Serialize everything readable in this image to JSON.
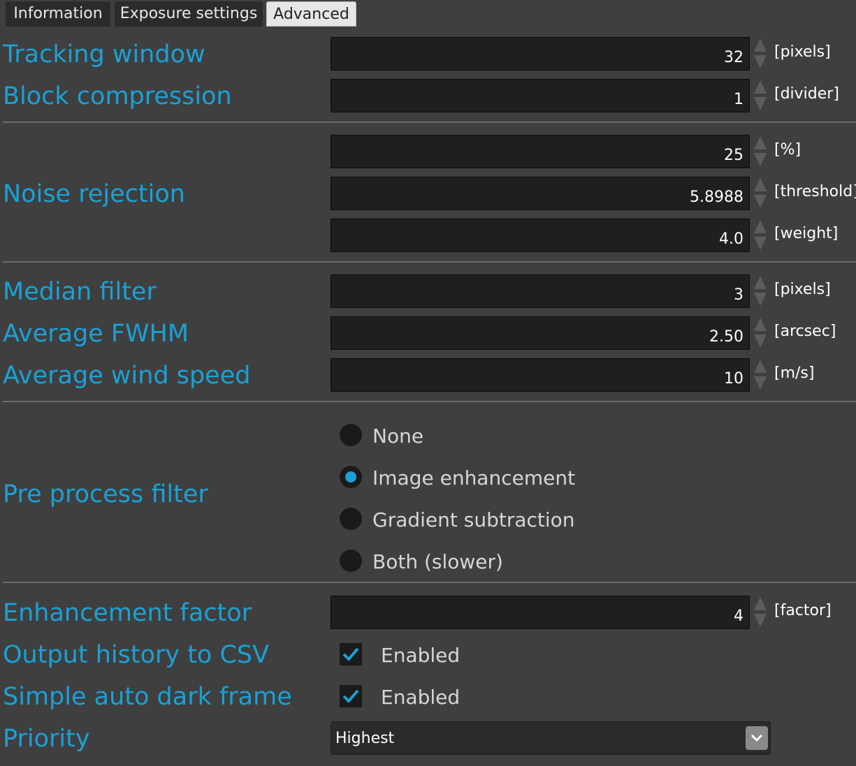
{
  "tabs": [
    {
      "label": "Information",
      "active": false
    },
    {
      "label": "Exposure settings",
      "active": false
    },
    {
      "label": "Advanced",
      "active": true
    }
  ],
  "tracking_window": {
    "label": "Tracking window",
    "value": "32",
    "unit": "[pixels]"
  },
  "block_compression": {
    "label": "Block compression",
    "value": "1",
    "unit": "[divider]"
  },
  "noise_rejection": {
    "label": "Noise rejection",
    "fields": [
      {
        "value": "25",
        "unit": "[%]"
      },
      {
        "value": "5.8988",
        "unit": "[threshold]"
      },
      {
        "value": "4.0",
        "unit": "[weight]"
      }
    ]
  },
  "median_filter": {
    "label": "Median filter",
    "value": "3",
    "unit": "[pixels]"
  },
  "average_fwhm": {
    "label": "Average FWHM",
    "value": "2.50",
    "unit": "[arcsec]"
  },
  "average_wind_speed": {
    "label": "Average wind speed",
    "value": "10",
    "unit": "[m/s]"
  },
  "pre_process_filter": {
    "label": "Pre process filter",
    "options": [
      "None",
      "Image enhancement",
      "Gradient subtraction",
      "Both (slower)"
    ],
    "selected": "Image enhancement"
  },
  "enhancement_factor": {
    "label": "Enhancement factor",
    "value": "4",
    "unit": "[factor]"
  },
  "output_history_csv": {
    "label": "Output history to CSV",
    "checked": true,
    "text": "Enabled"
  },
  "simple_auto_dark_frame": {
    "label": "Simple auto dark frame",
    "checked": true,
    "text": "Enabled"
  },
  "priority": {
    "label": "Priority",
    "value": "Highest"
  },
  "colors": {
    "accent": "#1aa1d6",
    "background": "#3f3f3f",
    "field": "#1f1f1f"
  }
}
